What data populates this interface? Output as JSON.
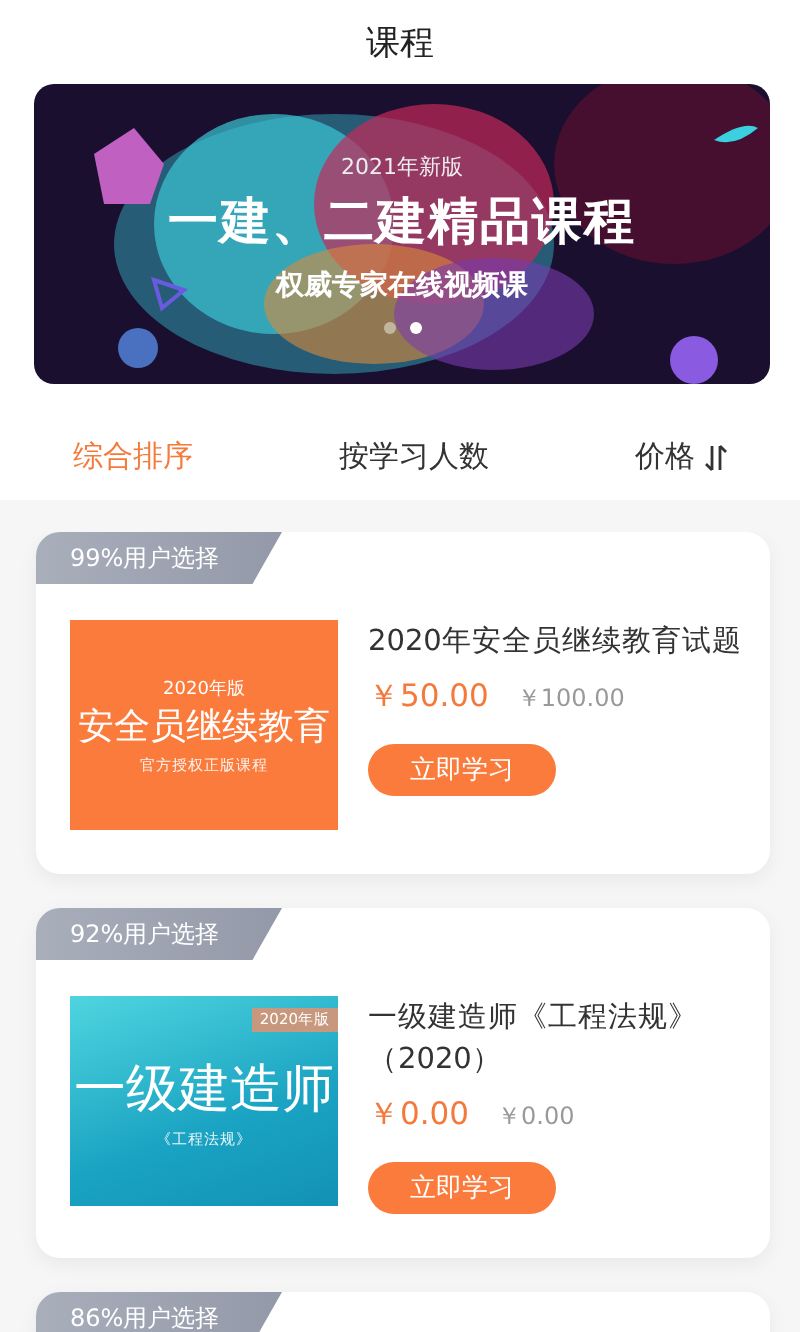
{
  "header": {
    "title": "课程"
  },
  "banner": {
    "kind": "picture",
    "edition": "2021年新版",
    "headline": "一建、二建精品课程",
    "subtitle": "权威专家在线视频课",
    "dots": [
      {
        "selected": false
      },
      {
        "selected": true
      }
    ]
  },
  "sort_tabs": [
    {
      "label": "综合排序",
      "selected": true,
      "kind": "plain"
    },
    {
      "label": "按学习人数",
      "selected": false,
      "kind": "plain"
    },
    {
      "label": "价格",
      "selected": false,
      "kind": "sortable"
    }
  ],
  "courses": [
    {
      "badge": "99%用户选择",
      "thumbnail": {
        "kind": "solid",
        "edition": "2020年版",
        "title": "安全员继续教育",
        "caption": "官方授权正版课程"
      },
      "title": "2020年安全员继续教育试题",
      "price": "￥50.00",
      "original_price": "￥100.00",
      "button": "立即学习"
    },
    {
      "badge": "92%用户选择",
      "thumbnail": {
        "kind": "gradient",
        "edition": "2020年版",
        "title": "一级建造师",
        "caption": "《工程法规》"
      },
      "title": "一级建造师《工程法规》（2020）",
      "price": "￥0.00",
      "original_price": "￥0.00",
      "button": "立即学习"
    },
    {
      "badge": "86%用户选择"
    }
  ]
}
